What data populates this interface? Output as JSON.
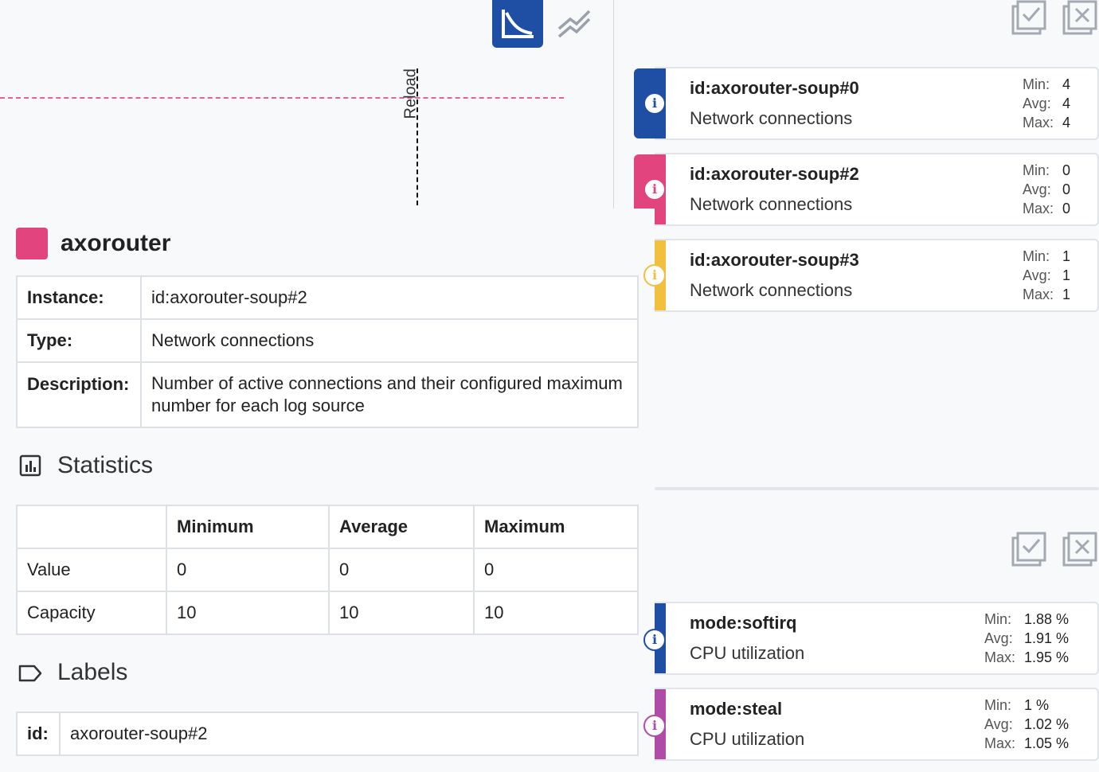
{
  "toolbar": {
    "active_icon": "chart-view-icon",
    "alt_icon": "trend-lines-icon"
  },
  "chart": {
    "reload_label": "Reload",
    "threshold_color": "#e8628b"
  },
  "header": {
    "title": "axorouter",
    "color": "#e2457e"
  },
  "details": {
    "rows": [
      {
        "label": "Instance:",
        "value": "id:axorouter-soup#2"
      },
      {
        "label": "Type:",
        "value": "Network connections"
      },
      {
        "label": "Description:",
        "value": "Number of active connections and their configured maximum number for each log source"
      }
    ]
  },
  "statistics": {
    "title": "Statistics",
    "headers": [
      "",
      "Minimum",
      "Average",
      "Maximum"
    ],
    "rows": [
      [
        "Value",
        "0",
        "0",
        "0"
      ],
      [
        "Capacity",
        "10",
        "10",
        "10"
      ]
    ]
  },
  "labels": {
    "title": "Labels",
    "rows": [
      {
        "key": "id:",
        "value": "axorouter-soup#2"
      }
    ]
  },
  "panel_top": {
    "select_all_icon": "check-all-icon",
    "clear_all_icon": "uncheck-all-icon",
    "series": [
      {
        "name": "id:axorouter-soup#0",
        "type": "Network connections",
        "min_label": "Min:",
        "min": "4",
        "avg_label": "Avg:",
        "avg": "4",
        "max_label": "Max:",
        "max": "4",
        "color": "#1f4fa5"
      },
      {
        "name": "id:axorouter-soup#2",
        "type": "Network connections",
        "min_label": "Min:",
        "min": "0",
        "avg_label": "Avg:",
        "avg": "0",
        "max_label": "Max:",
        "max": "0",
        "color": "#e2457e"
      },
      {
        "name": "id:axorouter-soup#3",
        "type": "Network connections",
        "min_label": "Min:",
        "min": "1",
        "avg_label": "Avg:",
        "avg": "1",
        "max_label": "Max:",
        "max": "1",
        "color": "#f2bf3e"
      }
    ]
  },
  "panel_bottom": {
    "select_all_icon": "check-all-icon",
    "clear_all_icon": "uncheck-all-icon",
    "series": [
      {
        "name": "mode:softirq",
        "type": "CPU utilization",
        "min_label": "Min:",
        "min": "1.88 %",
        "avg_label": "Avg:",
        "avg": "1.91 %",
        "max_label": "Max:",
        "max": "1.95 %",
        "color": "#1f4fa5"
      },
      {
        "name": "mode:steal",
        "type": "CPU utilization",
        "min_label": "Min:",
        "min": "1 %",
        "avg_label": "Avg:",
        "avg": "1.02 %",
        "max_label": "Max:",
        "max": "1.05 %",
        "color": "#b04ba8"
      }
    ]
  }
}
